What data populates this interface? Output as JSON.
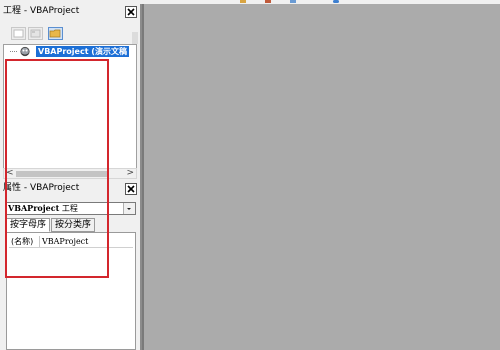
{
  "project_pane": {
    "title": "工程 - VBAProject",
    "tree": {
      "root_label": "VBAProject (演示文稿"
    }
  },
  "properties_pane": {
    "title": "属性 - VBAProject",
    "object_name": "VBAProject",
    "object_type": "工程",
    "tabs": [
      {
        "label": "按字母序",
        "active": true
      },
      {
        "label": "按分类序",
        "active": false
      }
    ],
    "rows": [
      {
        "name": "(名称)",
        "value": "VBAProject"
      }
    ]
  },
  "icons": {
    "close": "close-icon",
    "view-code": "view-code-icon",
    "view-object": "view-object-icon",
    "toggle-folders": "toggle-folders-icon",
    "project": "vba-project-icon",
    "scroll-left": "chevron-left-icon",
    "scroll-right": "chevron-right-icon",
    "dropdown": "chevron-down-icon"
  },
  "colors": {
    "selection": "#1c6fd6",
    "workspace": "#ababab",
    "annotation": "#d3262d"
  }
}
